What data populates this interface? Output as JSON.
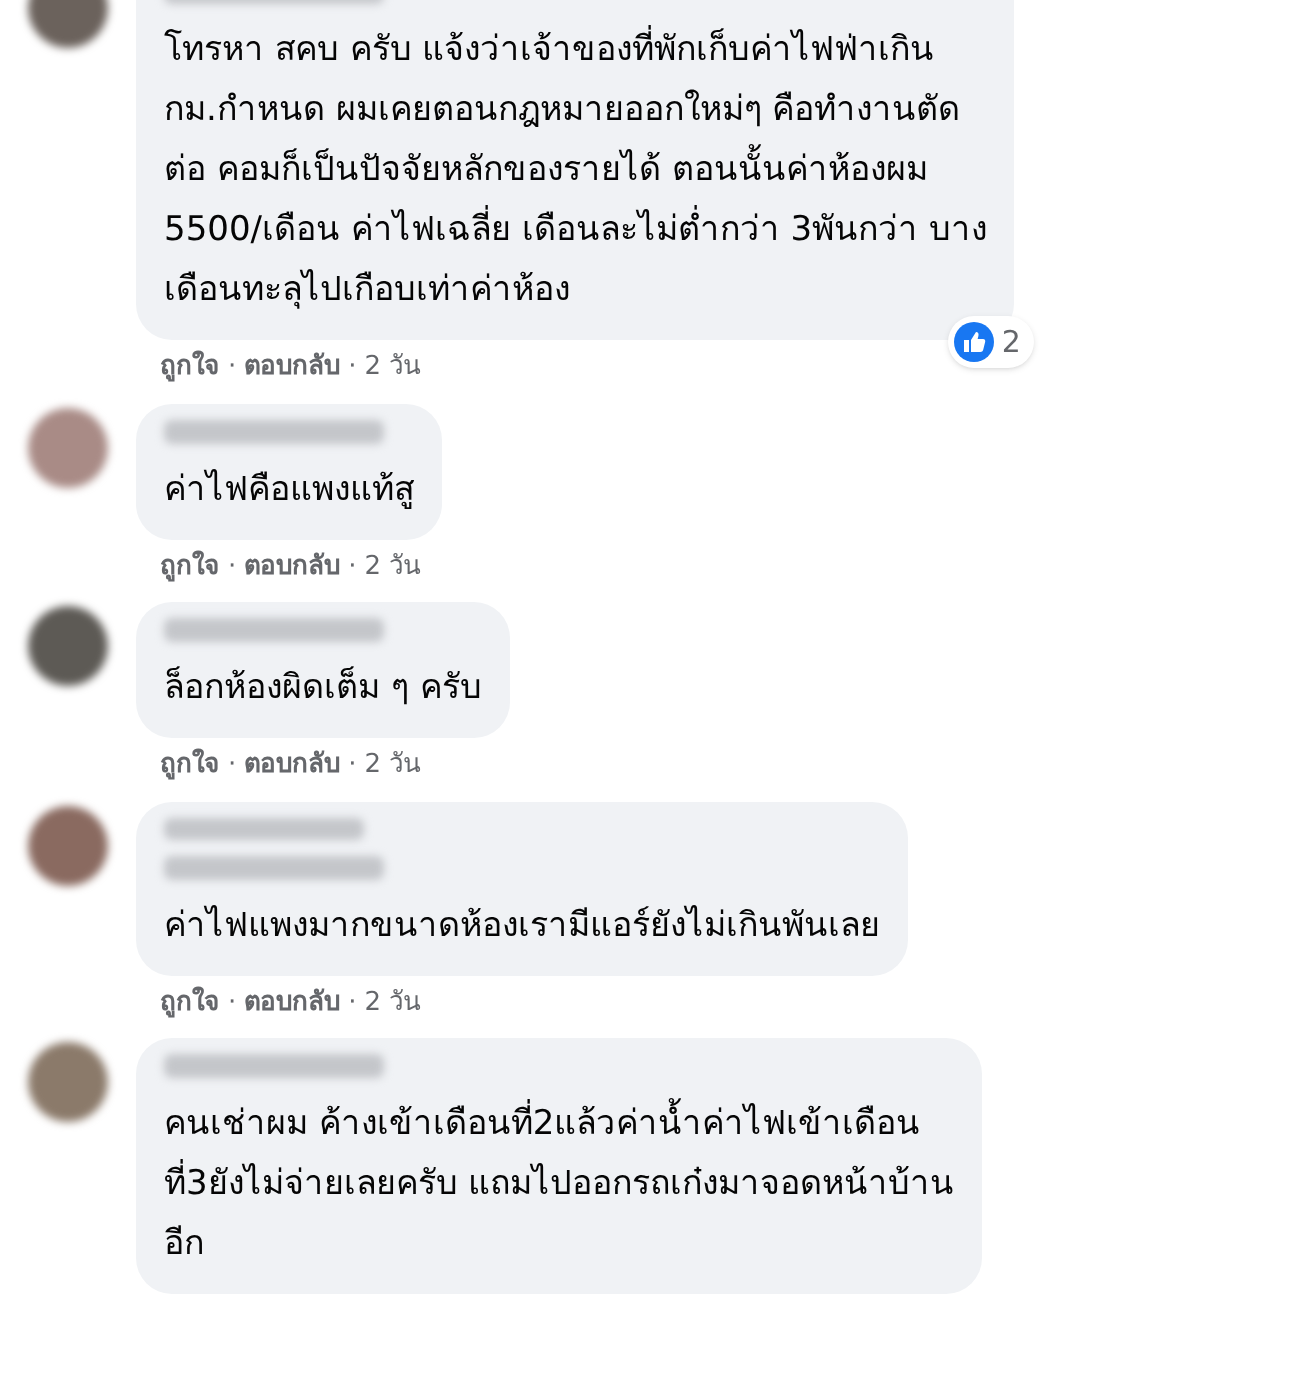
{
  "comments": [
    {
      "has_badge": false,
      "text": "โทรหา สคบ ครับ แจ้งว่าเจ้าของที่พักเก็บค่าไฟฟ่าเกิน\nกม.กำหนด ผมเคยตอนกฎหมายออกใหม่ๆ คือทำงานตัด\nต่อ คอมก็เป็นปัจจัยหลักของรายได้ ตอนนั้นค่าห้องผม\n5500/เดือน ค่าไฟเฉลี่ย เดือนละไม่ต่ำกว่า 3พันกว่า บาง\nเดือนทะลุไปเกือบเท่าค่าห้อง",
      "reactions": {
        "count": "2"
      },
      "like": "ถูกใจ",
      "reply": "ตอบกลับ",
      "time": "2 วัน"
    },
    {
      "has_badge": false,
      "text": "ค่าไฟคือแพงแท้สู",
      "like": "ถูกใจ",
      "reply": "ตอบกลับ",
      "time": "2 วัน"
    },
    {
      "has_badge": false,
      "text": "ล็อกห้องผิดเต็ม ๆ ครับ",
      "like": "ถูกใจ",
      "reply": "ตอบกลับ",
      "time": "2 วัน"
    },
    {
      "has_badge": true,
      "text": "ค่าไฟแพงมากขนาดห้องเรามีแอร์ยังไม่เกินพันเลย",
      "like": "ถูกใจ",
      "reply": "ตอบกลับ",
      "time": "2 วัน"
    },
    {
      "has_badge": false,
      "text": "คนเช่าผม ค้างเข้าเดือนที่2แล้วค่าน้ำค่าไฟเข้าเดือน\nที่3ยังไม่จ่ายเลยครับ แถมไปออกรถเก๋งมาจอดหน้าบ้าน\nอีก"
    }
  ],
  "separator": "·"
}
